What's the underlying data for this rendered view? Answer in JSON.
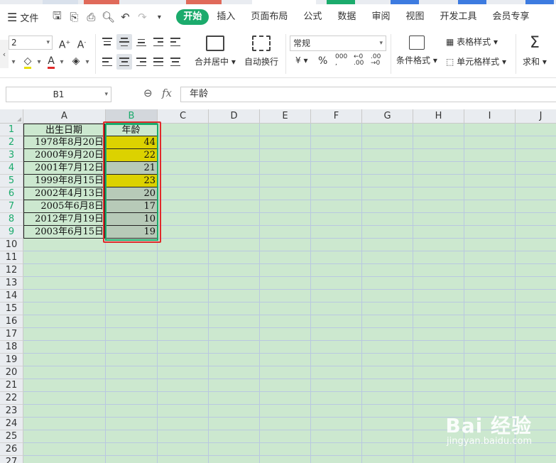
{
  "menu": {
    "file_label": "文件",
    "tabs": [
      {
        "label": "开始",
        "active": true
      },
      {
        "label": "插入"
      },
      {
        "label": "页面布局"
      },
      {
        "label": "公式"
      },
      {
        "label": "数据"
      },
      {
        "label": "审阅"
      },
      {
        "label": "视图"
      },
      {
        "label": "开发工具"
      },
      {
        "label": "会员专享"
      }
    ]
  },
  "ribbon": {
    "font_size": "2",
    "merge_center_label": "合并居中",
    "wrap_text_label": "自动换行",
    "number_format": "常规",
    "currency_symbol": "¥",
    "percent_symbol": "%",
    "table_style_label": "表格样式",
    "conditional_format_label": "条件格式",
    "cell_style_label": "单元格样式",
    "sum_label": "求和"
  },
  "formula_bar": {
    "cell_ref": "B1",
    "fx": "fx",
    "content": "年龄"
  },
  "sheet": {
    "columns": [
      "A",
      "B",
      "C",
      "D",
      "E",
      "F",
      "G",
      "H",
      "I",
      "J"
    ],
    "selected_column": "B",
    "rows": [
      "1",
      "2",
      "3",
      "4",
      "5",
      "6",
      "7",
      "8",
      "9",
      "10",
      "11",
      "12",
      "13",
      "14",
      "15",
      "16",
      "17",
      "18",
      "19",
      "20",
      "21",
      "22",
      "23",
      "24",
      "25",
      "26",
      "27"
    ],
    "header_a": "出生日期",
    "header_b": "年龄",
    "data": [
      {
        "date": "1978年8月20日",
        "age": "44",
        "highlight": true
      },
      {
        "date": "2000年9月20日",
        "age": "22",
        "highlight": true
      },
      {
        "date": "2001年7月12日",
        "age": "21",
        "highlight": false
      },
      {
        "date": "1999年8月15日",
        "age": "23",
        "highlight": true
      },
      {
        "date": "2002年4月13日",
        "age": "20",
        "highlight": false
      },
      {
        "date": "2005年6月8日",
        "age": "17",
        "highlight": false
      },
      {
        "date": "2012年7月19日",
        "age": "10",
        "highlight": false
      },
      {
        "date": "2003年6月15日",
        "age": "19",
        "highlight": false
      }
    ]
  },
  "colors": {
    "accent": "#1bab6c",
    "highlight_yellow": "#dcd200",
    "annotation_red": "#e02a2a",
    "sheet_background": "#cce8cf"
  },
  "watermark": {
    "brand": "Bai  经验",
    "sub": "jingyan.baidu.com"
  }
}
